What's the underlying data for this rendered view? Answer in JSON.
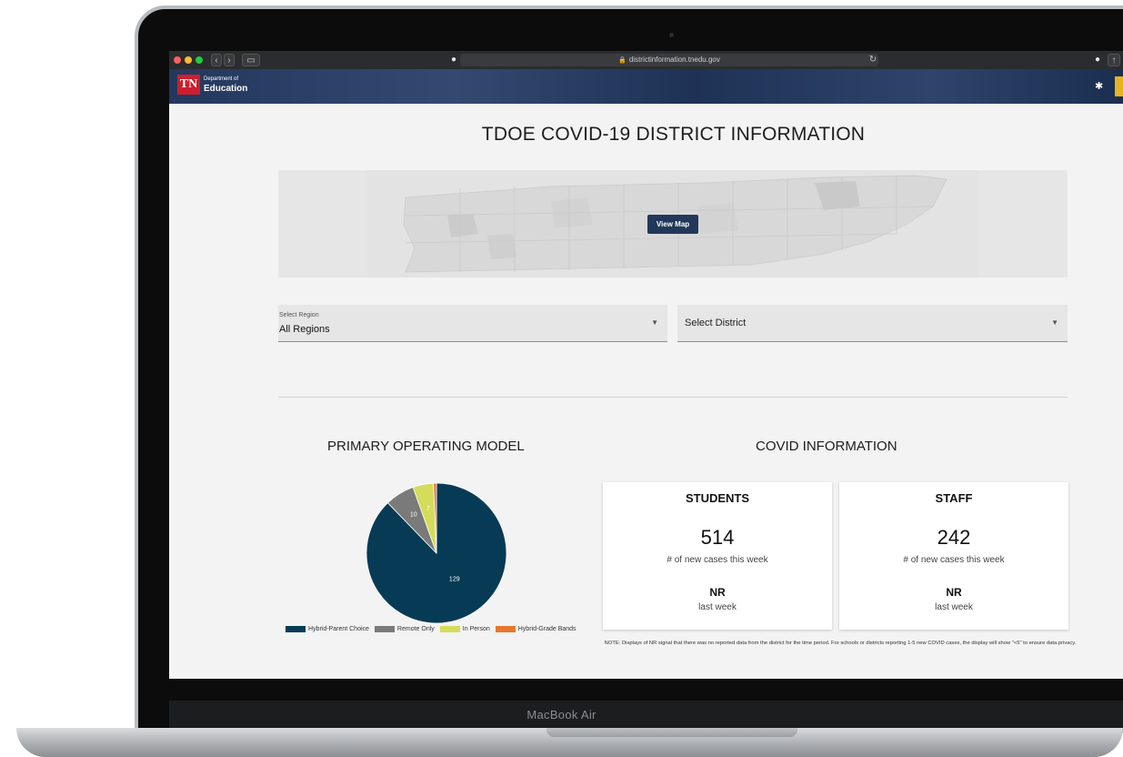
{
  "browser": {
    "url": "districtinformation.tnedu.gov"
  },
  "header": {
    "logo_text": "TN",
    "dept_line1": "Department of",
    "dept_line2": "Education"
  },
  "page": {
    "title": "TDOE COVID-19 DISTRICT INFORMATION",
    "view_map_label": "View Map"
  },
  "filters": {
    "region_label": "Select Region",
    "region_value": "All Regions",
    "district_placeholder": "Select District"
  },
  "operating_model": {
    "heading": "PRIMARY OPERATING MODEL"
  },
  "chart_data": {
    "type": "pie",
    "title": "PRIMARY OPERATING MODEL",
    "categories": [
      "Hybrid-Parent Choice",
      "Remote Only",
      "In Person",
      "Hybrid-Grade Bands"
    ],
    "values": [
      129,
      10,
      7,
      1
    ],
    "colors": [
      "#073b55",
      "#7a7a7a",
      "#d4dc5a",
      "#e8772e"
    ],
    "data_labels": [
      "129",
      "10",
      "7",
      ""
    ],
    "legend_position": "bottom"
  },
  "covid": {
    "heading": "COVID INFORMATION",
    "students": {
      "title": "STUDENTS",
      "count": "514",
      "count_label": "# of new cases this week",
      "last_week": "NR",
      "last_week_label": "last week"
    },
    "staff": {
      "title": "STAFF",
      "count": "242",
      "count_label": "# of new cases this week",
      "last_week": "NR",
      "last_week_label": "last week"
    },
    "note": "NOTE: Displays of NR signal that there was no reported data from the district for the time period. For schools or districts reporting 1-5 new COVID cases, the display will show \"<5\" to ensure data privacy."
  },
  "device": {
    "label": "MacBook Air"
  }
}
